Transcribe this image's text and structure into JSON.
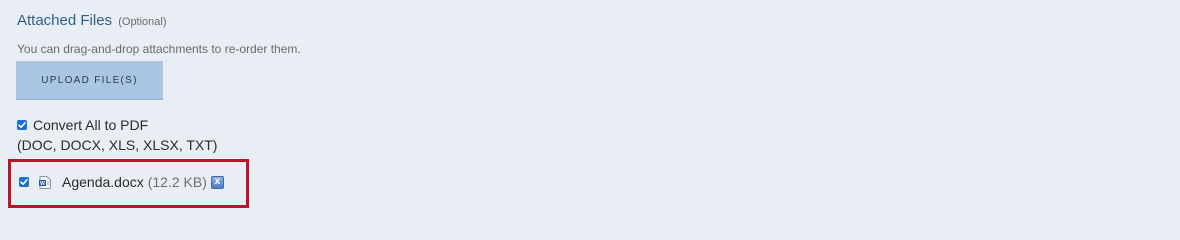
{
  "section": {
    "title": "Attached Files",
    "optional_label": "(Optional)",
    "hint": "You can drag-and-drop attachments to re-order them."
  },
  "upload": {
    "button_label": "UPLOAD FILE(S)"
  },
  "convert": {
    "checked": true,
    "label": "Convert All to PDF",
    "types": "(DOC, DOCX, XLS, XLSX, TXT)"
  },
  "files": [
    {
      "checked": true,
      "icon": "word-document-icon",
      "name": "Agenda.docx",
      "size": "(12.2 KB)",
      "remove_glyph": "x"
    }
  ],
  "colors": {
    "background": "#e9eef4",
    "title": "#2d5f8a",
    "button": "#a9c6e3",
    "highlight_border": "#c0132b",
    "checkbox": "#1f6fd1"
  }
}
